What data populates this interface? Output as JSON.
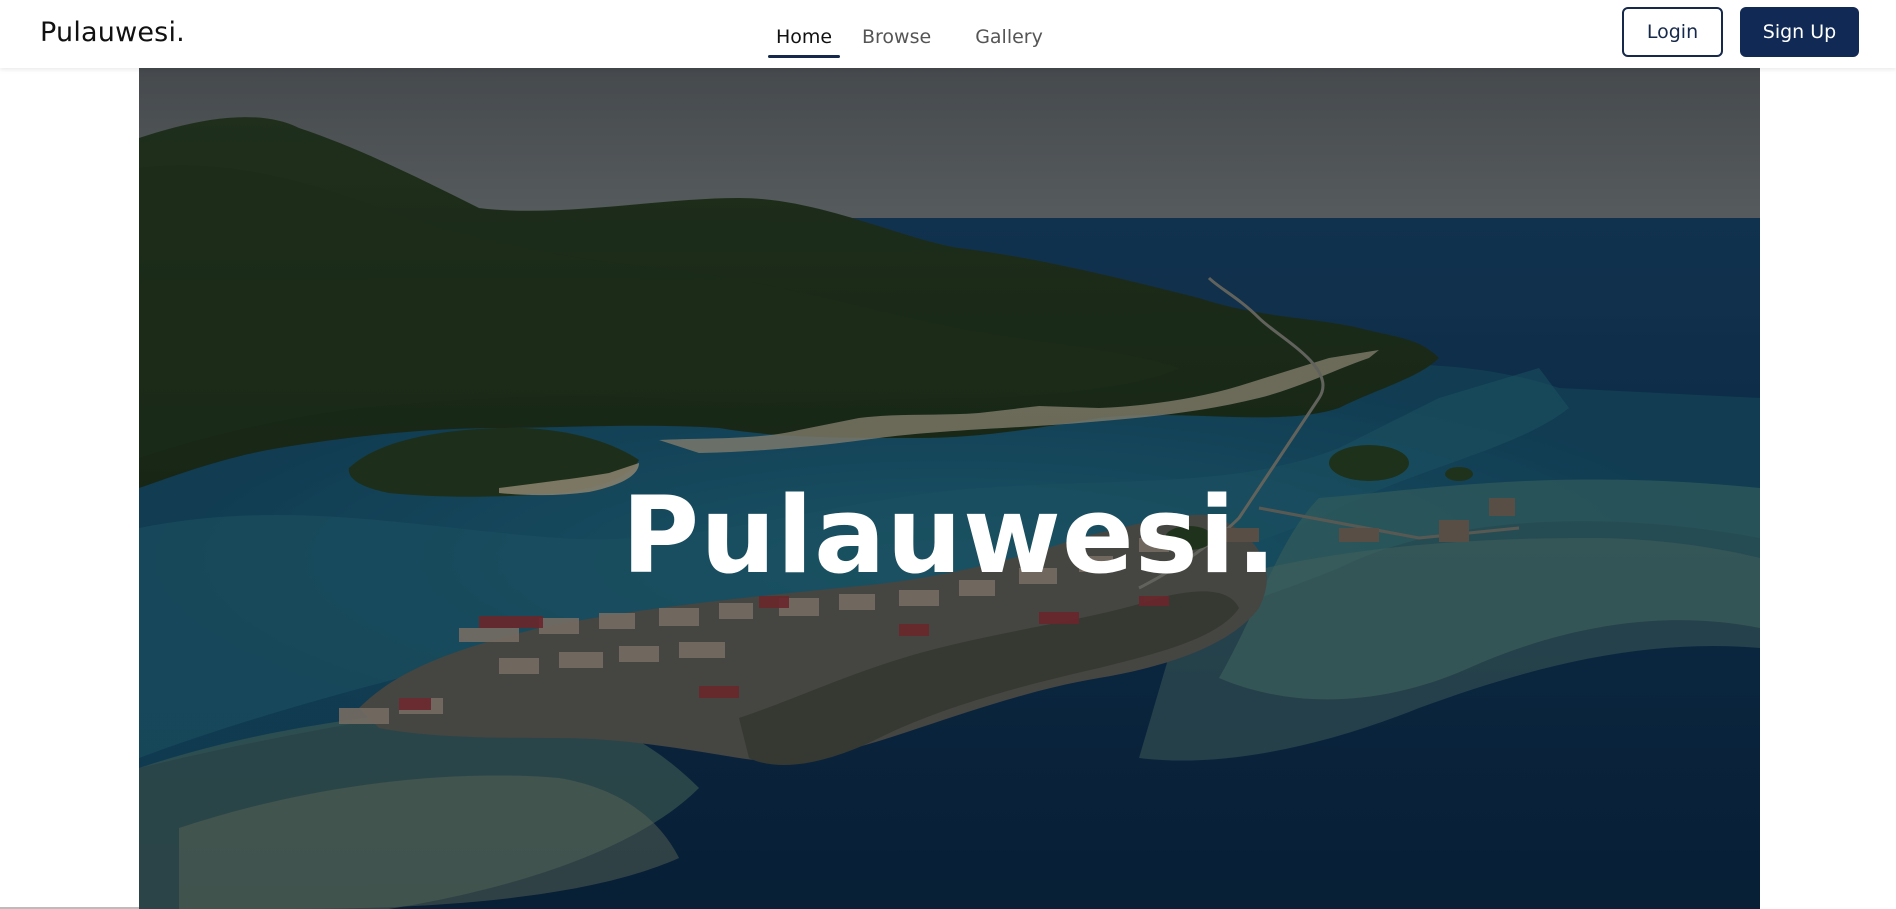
{
  "header": {
    "brand": "Pulauwesi.",
    "nav": [
      {
        "label": "Home",
        "active": true
      },
      {
        "label": "Browse",
        "active": false
      },
      {
        "label": "Gallery",
        "active": false
      }
    ],
    "login_label": "Login",
    "signup_label": "Sign Up"
  },
  "hero": {
    "title": "Pulauwesi.",
    "image_subject": "aerial photo of a forested island, turquoise reef lagoon and a stilt-house village connected by a long causeway"
  },
  "colors": {
    "primary": "#112a55",
    "brand_text": "#111111",
    "nav_text": "#555555",
    "white": "#ffffff"
  }
}
